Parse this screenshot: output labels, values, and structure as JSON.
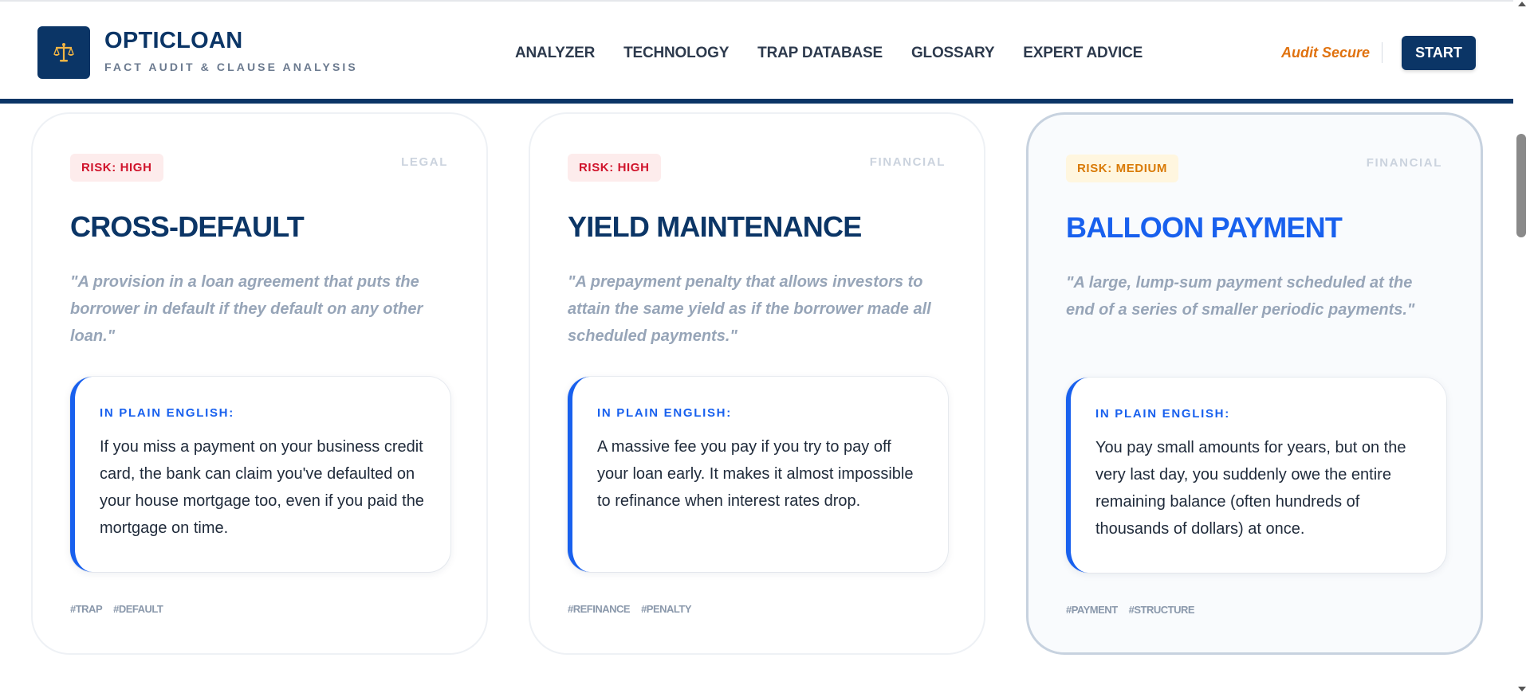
{
  "header": {
    "brand_title": "OPTICLOAN",
    "brand_subtitle": "FACT AUDIT & CLAUSE ANALYSIS",
    "logo_icon": "scales-icon",
    "nav": [
      "ANALYZER",
      "TECHNOLOGY",
      "TRAP DATABASE",
      "GLOSSARY",
      "EXPERT ADVICE"
    ],
    "audit_label": "Audit Secure",
    "start_label": "START"
  },
  "colors": {
    "navy": "#0b3566",
    "accent_blue": "#1860ee",
    "risk_high": "#d0142c",
    "risk_medium": "#d97a06",
    "audit_orange": "#e0720f"
  },
  "cards": [
    {
      "risk": "RISK: HIGH",
      "category": "LEGAL",
      "term": "CROSS-DEFAULT",
      "quote": "\"A provision in a loan agreement that puts the borrower in default if they default on any other loan.\"",
      "plain_label": "IN PLAIN ENGLISH:",
      "plain_text": "If you miss a payment on your business credit card, the bank can claim you've defaulted on your house mortgage too, even if you paid the mortgage on time.",
      "tags": [
        "#TRAP",
        "#DEFAULT"
      ]
    },
    {
      "risk": "RISK: HIGH",
      "category": "FINANCIAL",
      "term": "YIELD MAINTENANCE",
      "quote": "\"A prepayment penalty that allows investors to attain the same yield as if the borrower made all scheduled payments.\"",
      "plain_label": "IN PLAIN ENGLISH:",
      "plain_text": "A massive fee you pay if you try to pay off your loan early. It makes it almost impossible to refinance when interest rates drop.",
      "tags": [
        "#REFINANCE",
        "#PENALTY"
      ]
    },
    {
      "risk": "RISK: MEDIUM",
      "category": "FINANCIAL",
      "term": "BALLOON PAYMENT",
      "quote": "\"A large, lump-sum payment scheduled at the end of a series of smaller periodic payments.\"",
      "plain_label": "IN PLAIN ENGLISH:",
      "plain_text": "You pay small amounts for years, but on the very last day, you suddenly owe the entire remaining balance (often hundreds of thousands of dollars) at once.",
      "tags": [
        "#PAYMENT",
        "#STRUCTURE"
      ]
    }
  ]
}
